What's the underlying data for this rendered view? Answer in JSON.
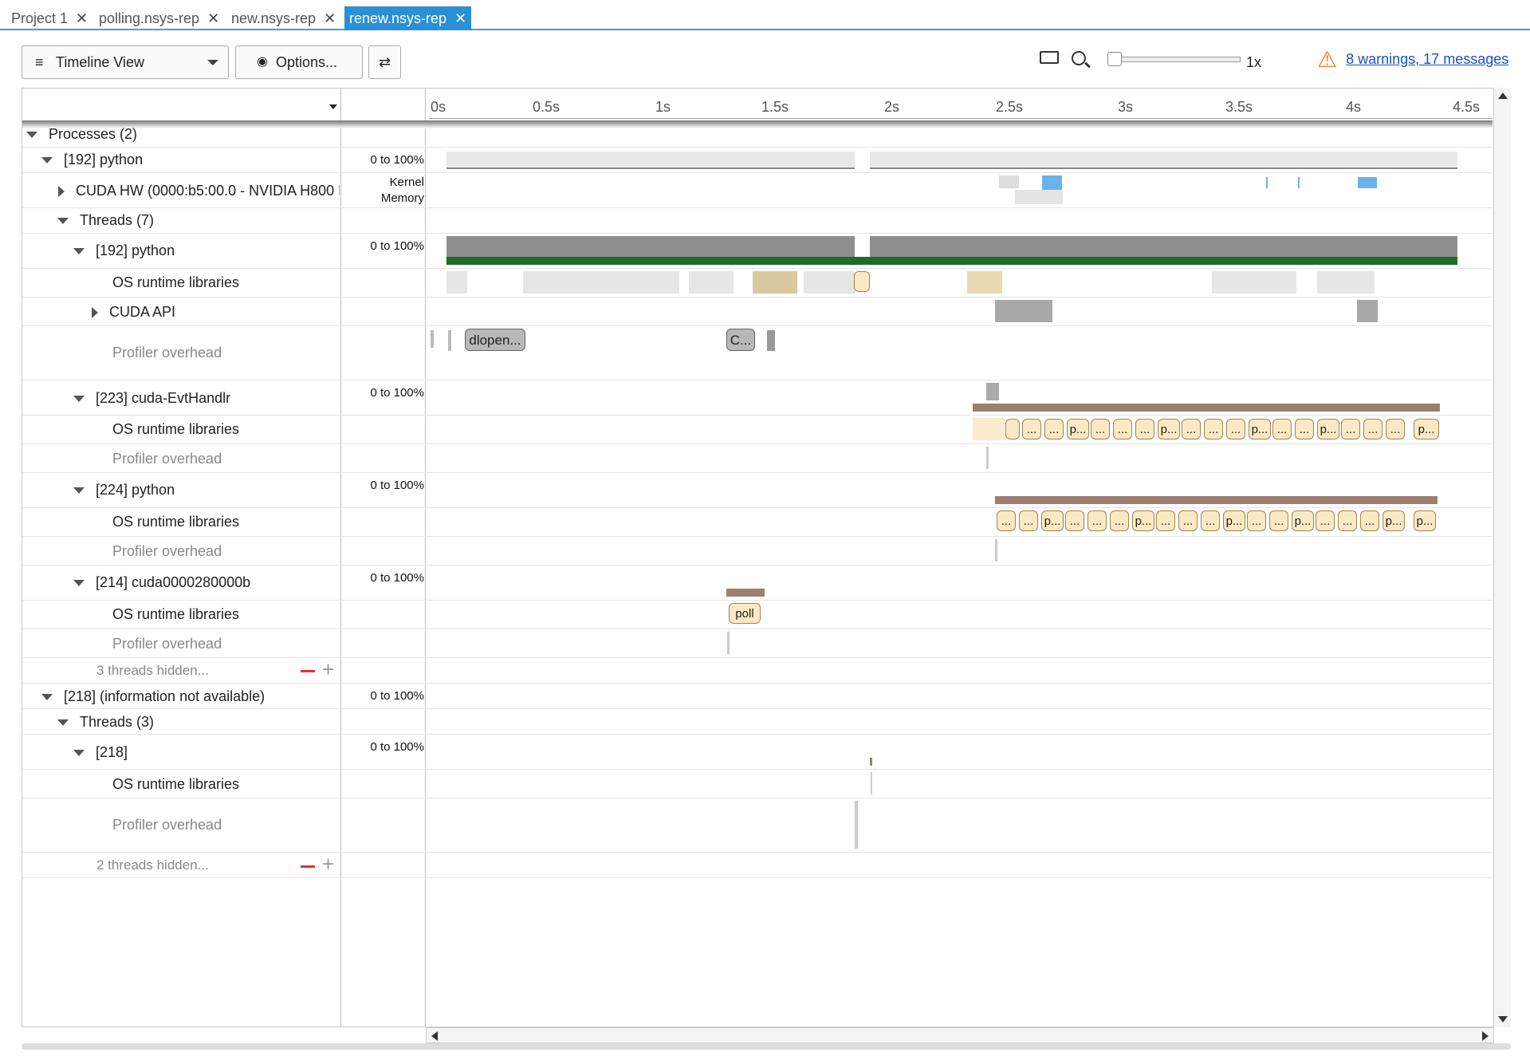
{
  "tabs": [
    {
      "label": "Project 1"
    },
    {
      "label": "polling.nsys-rep"
    },
    {
      "label": "new.nsys-rep"
    },
    {
      "label": "renew.nsys-rep"
    }
  ],
  "toolbar": {
    "view_label": "Timeline View",
    "options_label": "Options...",
    "zoom_level": "1x",
    "warnings_link": "8 warnings, 17 messages"
  },
  "timeline": {
    "ticks": [
      "0s",
      "0.5s",
      "1s",
      "1.5s",
      "2s",
      "2.5s",
      "3s",
      "3.5s",
      "4s",
      "4.5s"
    ]
  },
  "rows": {
    "processes": "Processes (2)",
    "p192": "[192] python",
    "cuda_hw": "CUDA HW (0000:b5:00.0 - NVIDIA H800 P",
    "cuda_hw_range_1": "Kernel",
    "cuda_hw_range_2": "Memory",
    "threads7": "Threads (7)",
    "t192": "[192] python",
    "os_rt": "OS runtime libraries",
    "cuda_api": "CUDA API",
    "prof_overhead": "Profiler overhead",
    "t223": "[223] cuda-EvtHandlr",
    "t224": "[224] python",
    "t214": "[214] cuda0000280000b",
    "hidden3": "3 threads hidden...",
    "p218": "[218] (information not available)",
    "threads3": "Threads (3)",
    "t218": "[218]",
    "hidden2": "2 threads hidden...",
    "range": "0 to 100%"
  },
  "events": {
    "dlopen": "dlopen...",
    "c": "C...",
    "poll": "poll",
    "ellipsis": "...",
    "p": "p..."
  }
}
